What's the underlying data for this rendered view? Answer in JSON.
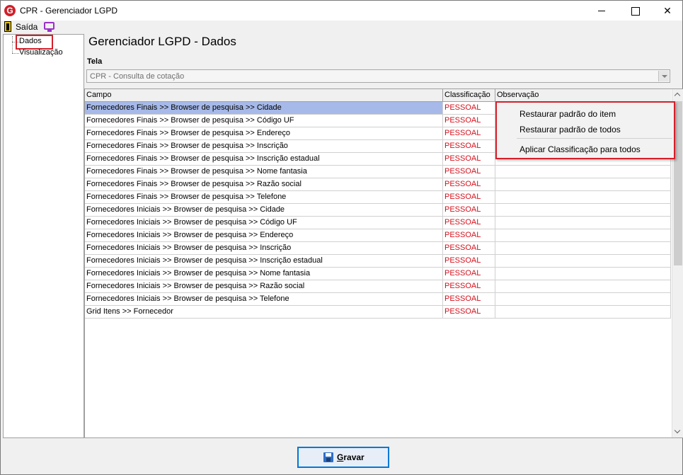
{
  "window": {
    "title": "CPR - Gerenciador LGPD",
    "close_glyph": "✕"
  },
  "menubar": {
    "exit_label": "Saída"
  },
  "tree": {
    "items": [
      {
        "label": "Dados",
        "highlighted": true
      },
      {
        "label": "Visualização",
        "highlighted": false
      }
    ]
  },
  "main": {
    "title": "Gerenciador LGPD - Dados",
    "tela_label": "Tela",
    "tela_value": "CPR - Consulta de cotação"
  },
  "grid": {
    "columns": [
      "Campo",
      "Classificação",
      "Observação"
    ],
    "rows": [
      {
        "campo": "Fornecedores Finais >> Browser de pesquisa >> Cidade",
        "classificacao": "PESSOAL",
        "observacao": "",
        "selected": true
      },
      {
        "campo": "Fornecedores Finais >> Browser de pesquisa >> Código UF",
        "classificacao": "PESSOAL",
        "observacao": ""
      },
      {
        "campo": "Fornecedores Finais >> Browser de pesquisa >> Endereço",
        "classificacao": "PESSOAL",
        "observacao": ""
      },
      {
        "campo": "Fornecedores Finais >> Browser de pesquisa >> Inscrição",
        "classificacao": "PESSOAL",
        "observacao": ""
      },
      {
        "campo": "Fornecedores Finais >> Browser de pesquisa >> Inscrição estadual",
        "classificacao": "PESSOAL",
        "observacao": ""
      },
      {
        "campo": "Fornecedores Finais >> Browser de pesquisa >> Nome fantasia",
        "classificacao": "PESSOAL",
        "observacao": ""
      },
      {
        "campo": "Fornecedores Finais >> Browser de pesquisa >> Razão social",
        "classificacao": "PESSOAL",
        "observacao": ""
      },
      {
        "campo": "Fornecedores Finais >> Browser de pesquisa >> Telefone",
        "classificacao": "PESSOAL",
        "observacao": ""
      },
      {
        "campo": "Fornecedores Iniciais >> Browser de pesquisa >> Cidade",
        "classificacao": "PESSOAL",
        "observacao": ""
      },
      {
        "campo": "Fornecedores Iniciais >> Browser de pesquisa >> Código UF",
        "classificacao": "PESSOAL",
        "observacao": ""
      },
      {
        "campo": "Fornecedores Iniciais >> Browser de pesquisa >> Endereço",
        "classificacao": "PESSOAL",
        "observacao": ""
      },
      {
        "campo": "Fornecedores Iniciais >> Browser de pesquisa >> Inscrição",
        "classificacao": "PESSOAL",
        "observacao": ""
      },
      {
        "campo": "Fornecedores Iniciais >> Browser de pesquisa >> Inscrição estadual",
        "classificacao": "PESSOAL",
        "observacao": ""
      },
      {
        "campo": "Fornecedores Iniciais >> Browser de pesquisa >> Nome fantasia",
        "classificacao": "PESSOAL",
        "observacao": ""
      },
      {
        "campo": "Fornecedores Iniciais >> Browser de pesquisa >> Razão social",
        "classificacao": "PESSOAL",
        "observacao": ""
      },
      {
        "campo": "Fornecedores Iniciais >> Browser de pesquisa >> Telefone",
        "classificacao": "PESSOAL",
        "observacao": ""
      },
      {
        "campo": "Grid Itens >> Fornecedor",
        "classificacao": "PESSOAL",
        "observacao": ""
      }
    ]
  },
  "context_menu": {
    "items": [
      "Restaurar padrão do item",
      "Restaurar padrão de todos",
      "Aplicar Classificação para todos"
    ]
  },
  "footer": {
    "save_label_underlined": "G",
    "save_label_rest": "ravar"
  },
  "colors": {
    "classification_text": "#d4101c",
    "selected_row": "#a6b9e8",
    "highlight_border": "#d4202a",
    "button_border": "#0078d7"
  },
  "icons": {
    "app": "app-logo-icon",
    "exit": "exit-door-icon",
    "monitor": "monitor-icon",
    "save": "floppy-save-icon"
  }
}
